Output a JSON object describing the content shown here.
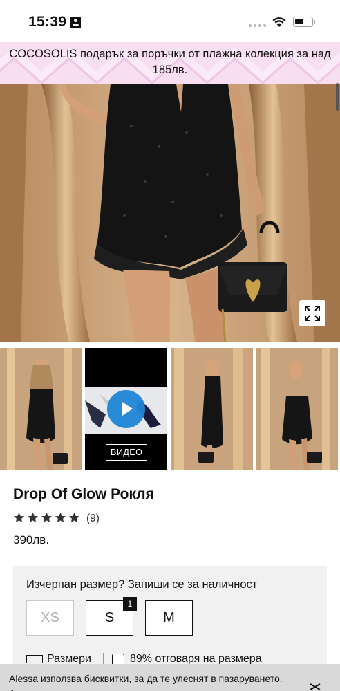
{
  "status_bar": {
    "time": "15:39"
  },
  "promo": {
    "text": "COCOSOLIS подарък за поръчки от плажна колекция за над 185лв."
  },
  "gallery": {
    "thumbnails": [
      "product-photo",
      "video",
      "product-photo",
      "product-photo"
    ],
    "video_label": "ВИДЕО"
  },
  "product": {
    "title": "Drop Of Glow Рокля",
    "rating": 5,
    "review_count": "(9)",
    "price": "390лв."
  },
  "sizes": {
    "out_of_stock_prompt": "Изчерпан размер?",
    "notify_link": "Запиши се за наличност",
    "options": [
      {
        "label": "XS",
        "available": false
      },
      {
        "label": "S",
        "available": true,
        "badge": "1"
      },
      {
        "label": "M",
        "available": true
      }
    ],
    "size_guide_label": "Размери",
    "fit_text": "89% отговаря на размера"
  },
  "cookie": {
    "text": "Alessa използва бисквитки, за да те улеснят в пазаруването. Ако продължиш да използваш услугите ни, ще приемем, че си"
  },
  "colors": {
    "accent": "#1f87d6",
    "promo_bg": "#f7dff1",
    "size_box_bg": "#f1f1f1"
  }
}
